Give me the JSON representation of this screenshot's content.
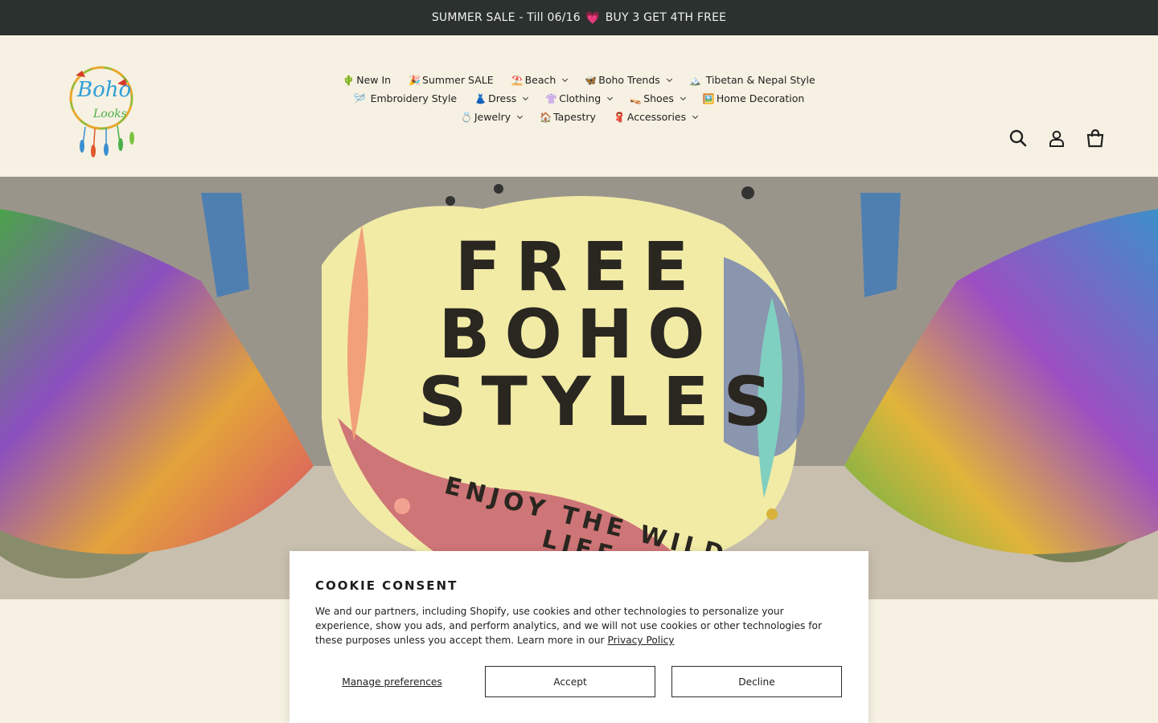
{
  "announcement": {
    "text_before": "SUMMER SALE - Till 06/16",
    "heart": "💗",
    "text_after": "BUY 3 GET 4TH FREE"
  },
  "logo": {
    "alt": "Boho Looks",
    "word1": "Boho",
    "word2": "Looks"
  },
  "nav": {
    "row1": [
      {
        "emoji": "🌵",
        "label": "New In",
        "dropdown": false
      },
      {
        "emoji": "🎉",
        "label": "Summer SALE",
        "dropdown": false
      },
      {
        "emoji": "⛱️",
        "label": "Beach",
        "dropdown": true
      },
      {
        "emoji": "🦋",
        "label": "Boho Trends",
        "dropdown": true
      },
      {
        "emoji": "🏔️",
        "label": " Tibetan & Nepal Style",
        "dropdown": false
      }
    ],
    "row2": [
      {
        "emoji": "🪡",
        "label": " Embroidery Style",
        "dropdown": false
      },
      {
        "emoji": "👗",
        "label": "Dress",
        "dropdown": true
      },
      {
        "emoji": "👚",
        "label": "Clothing",
        "dropdown": true
      },
      {
        "emoji": "👡",
        "label": "Shoes",
        "dropdown": true
      },
      {
        "emoji": "🖼️",
        "label": "Home Decoration",
        "dropdown": false
      }
    ],
    "row3": [
      {
        "emoji": "💍",
        "label": "Jewelry",
        "dropdown": true
      },
      {
        "emoji": "🏠",
        "label": "Tapestry",
        "dropdown": false
      },
      {
        "emoji": "🧣",
        "label": "Accessories",
        "dropdown": true
      }
    ]
  },
  "header_icons": [
    "search-icon",
    "account-icon",
    "cart-icon"
  ],
  "hero": {
    "line1": "FREE",
    "line2": "BOHO",
    "line3": "STYLES",
    "tagline": "ENJOY THE WILD LIFE"
  },
  "cookie": {
    "title": "COOKIE CONSENT",
    "body": "We and our partners, including Shopify, use cookies and other technologies to personalize your experience, show you ads, and perform analytics, and we will not use cookies or other technologies for these purposes unless you accept them. Learn more in our ",
    "policy_link": "Privacy Policy",
    "manage_label": "Manage preferences",
    "accept_label": "Accept",
    "decline_label": "Decline"
  },
  "colors": {
    "announcement_bg": "#2b312e",
    "page_bg": "#f6f1e2"
  }
}
